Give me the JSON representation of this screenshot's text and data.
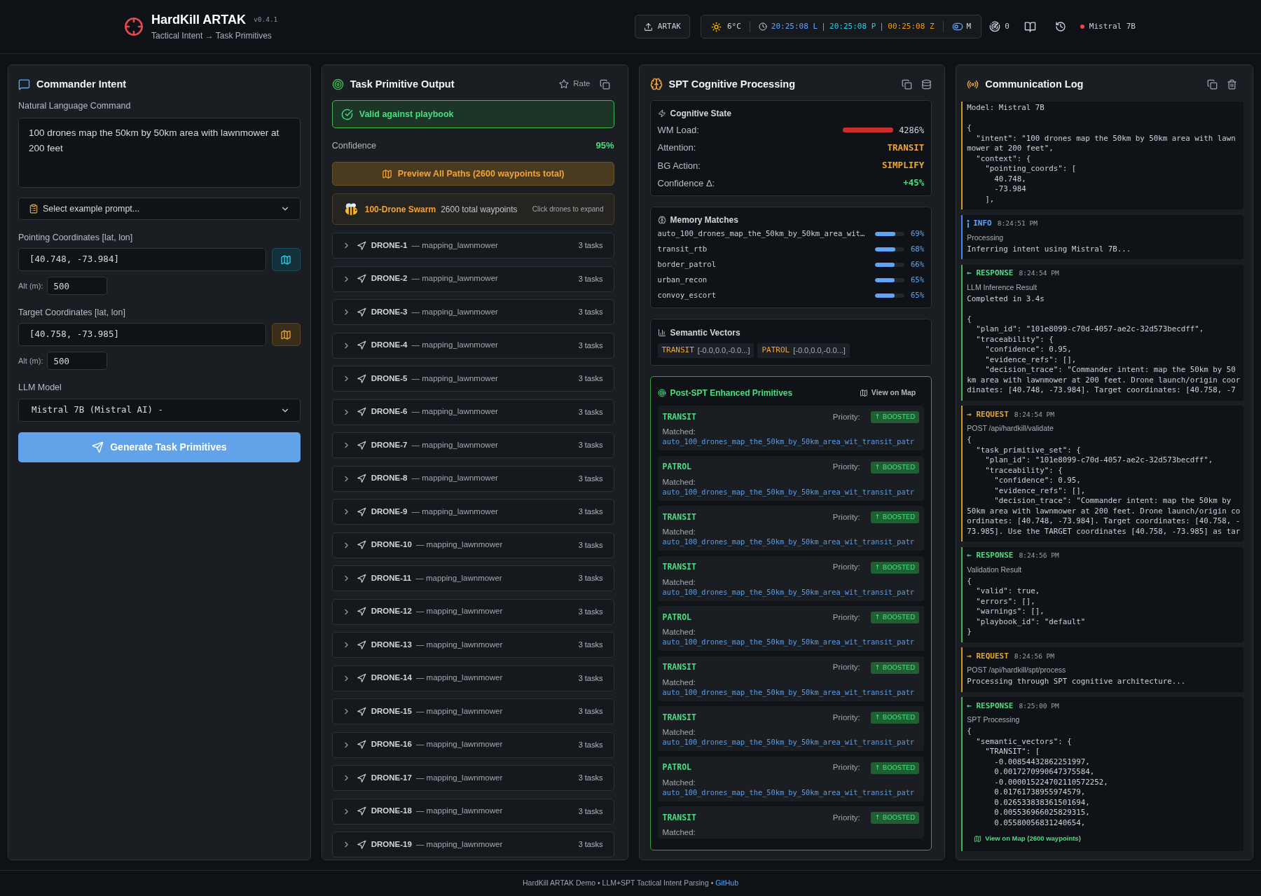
{
  "header": {
    "title": "HardKill ARTAK",
    "version": "v0.4.1",
    "subtitle": "Tactical Intent → Task Primitives",
    "export_button": "ARTAK",
    "temperature": "6°C",
    "clocks": [
      {
        "time": "20:25:08 L",
        "color": "#60a5fa"
      },
      {
        "time": "20:25:08 P",
        "color": "#22d3ee"
      },
      {
        "time": "00:25:08 Z",
        "color": "#f59e0b"
      }
    ],
    "mode": "M",
    "count": "0",
    "model_status": {
      "label": "Mistral 7B",
      "connected": false
    }
  },
  "commander_intent": {
    "title": "Commander Intent",
    "command": {
      "label": "Natural Language Command",
      "value": "100 drones map the 50km by 50km area with lawnmower at 200 feet"
    },
    "example_select": "Select example prompt...",
    "coordinates": [
      {
        "kind": "pointing",
        "label": "Pointing Coordinates [lat, lon]",
        "value": "[40.748, -73.984]",
        "alt_label": "Alt (m):",
        "alt_value": "500"
      },
      {
        "kind": "target",
        "label": "Target Coordinates [lat, lon]",
        "value": "[40.758, -73.985]",
        "alt_label": "Alt (m):",
        "alt_value": "500"
      }
    ],
    "model": {
      "label": "LLM Model",
      "value": "Mistral 7B (Mistral AI) -"
    },
    "generate_button": "Generate Task Primitives"
  },
  "task_output": {
    "title": "Task Primitive Output",
    "rate_button": "Rate",
    "validation": {
      "valid": true,
      "message": "Valid against playbook"
    },
    "confidence": {
      "label": "Confidence",
      "value": "95%"
    },
    "preview_button": "Preview All Paths (2600 waypoints total)",
    "swarm": {
      "name": "100-Drone Swarm",
      "waypoints": "2600 total waypoints",
      "hint": "Click drones to expand"
    },
    "drones": [
      {
        "name": "DRONE-1",
        "pattern": "— mapping_lawnmower",
        "tasks": "3 tasks",
        "expanded": false
      },
      {
        "name": "DRONE-2",
        "pattern": "— mapping_lawnmower",
        "tasks": "3 tasks",
        "expanded": false
      },
      {
        "name": "DRONE-3",
        "pattern": "— mapping_lawnmower",
        "tasks": "3 tasks",
        "expanded": false
      },
      {
        "name": "DRONE-4",
        "pattern": "— mapping_lawnmower",
        "tasks": "3 tasks",
        "expanded": false
      },
      {
        "name": "DRONE-5",
        "pattern": "— mapping_lawnmower",
        "tasks": "3 tasks",
        "expanded": false
      },
      {
        "name": "DRONE-6",
        "pattern": "— mapping_lawnmower",
        "tasks": "3 tasks",
        "expanded": false
      },
      {
        "name": "DRONE-7",
        "pattern": "— mapping_lawnmower",
        "tasks": "3 tasks",
        "expanded": false
      },
      {
        "name": "DRONE-8",
        "pattern": "— mapping_lawnmower",
        "tasks": "3 tasks",
        "expanded": false
      },
      {
        "name": "DRONE-9",
        "pattern": "— mapping_lawnmower",
        "tasks": "3 tasks",
        "expanded": false
      },
      {
        "name": "DRONE-10",
        "pattern": "— mapping_lawnmower",
        "tasks": "3 tasks",
        "expanded": false
      },
      {
        "name": "DRONE-11",
        "pattern": "— mapping_lawnmower",
        "tasks": "3 tasks",
        "expanded": false
      },
      {
        "name": "DRONE-12",
        "pattern": "— mapping_lawnmower",
        "tasks": "3 tasks",
        "expanded": false
      },
      {
        "name": "DRONE-13",
        "pattern": "— mapping_lawnmower",
        "tasks": "3 tasks",
        "expanded": false
      },
      {
        "name": "DRONE-14",
        "pattern": "— mapping_lawnmower",
        "tasks": "3 tasks",
        "expanded": false
      },
      {
        "name": "DRONE-15",
        "pattern": "— mapping_lawnmower",
        "tasks": "3 tasks",
        "expanded": false
      },
      {
        "name": "DRONE-16",
        "pattern": "— mapping_lawnmower",
        "tasks": "3 tasks",
        "expanded": false
      },
      {
        "name": "DRONE-17",
        "pattern": "— mapping_lawnmower",
        "tasks": "3 tasks",
        "expanded": false
      },
      {
        "name": "DRONE-18",
        "pattern": "— mapping_lawnmower",
        "tasks": "3 tasks",
        "expanded": false
      },
      {
        "name": "DRONE-19",
        "pattern": "— mapping_lawnmower",
        "tasks": "3 tasks",
        "expanded": false
      }
    ]
  },
  "spt": {
    "title": "SPT Cognitive Processing",
    "cognitive_state": {
      "title": "Cognitive State",
      "rows": [
        {
          "kind": "meter",
          "label": "WM Load:",
          "level": 1,
          "reading": "4286%"
        },
        {
          "kind": "value",
          "label": "Attention:",
          "value": "TRANSIT",
          "color": "#f0a43a"
        },
        {
          "kind": "value",
          "label": "BG Action:",
          "value": "SIMPLIFY",
          "color": "#f0a43a"
        },
        {
          "kind": "value",
          "label": "Confidence Δ:",
          "value": "+45%",
          "color": "#4ade80"
        }
      ]
    },
    "memory_matches": {
      "title": "Memory Matches",
      "items": [
        {
          "name": "auto_100_drones_map_the_50km_by_50km_area_wit…",
          "level": 0.69,
          "reading": "69%"
        },
        {
          "name": "transit_rtb",
          "level": 0.68,
          "reading": "68%"
        },
        {
          "name": "border_patrol",
          "level": 0.66,
          "reading": "66%"
        },
        {
          "name": "urban_recon",
          "level": 0.65,
          "reading": "65%"
        },
        {
          "name": "convoy_escort",
          "level": 0.65,
          "reading": "65%"
        }
      ]
    },
    "semantic_vectors": {
      "title": "Semantic Vectors",
      "items": [
        {
          "name": "TRANSIT",
          "values": "[-0.0,0.0,-0.0...]"
        },
        {
          "name": "PATROL",
          "values": "[-0.0,0.0,-0.0...]"
        }
      ]
    },
    "enhanced_primitives": {
      "title": "Post-SPT Enhanced Primitives",
      "map_link": "View on Map",
      "items": [
        {
          "type": "TRANSIT",
          "priority_label": "Priority:",
          "priority": "↑ BOOSTED",
          "matched_label": "Matched:",
          "matched": "auto_100_drones_map_the_50km_by_50km_area_wit_transit_patr"
        },
        {
          "type": "PATROL",
          "priority_label": "Priority:",
          "priority": "↑ BOOSTED",
          "matched_label": "Matched:",
          "matched": "auto_100_drones_map_the_50km_by_50km_area_wit_transit_patr"
        },
        {
          "type": "TRANSIT",
          "priority_label": "Priority:",
          "priority": "↑ BOOSTED",
          "matched_label": "Matched:",
          "matched": "auto_100_drones_map_the_50km_by_50km_area_wit_transit_patr"
        },
        {
          "type": "TRANSIT",
          "priority_label": "Priority:",
          "priority": "↑ BOOSTED",
          "matched_label": "Matched:",
          "matched": "auto_100_drones_map_the_50km_by_50km_area_wit_transit_patr"
        },
        {
          "type": "PATROL",
          "priority_label": "Priority:",
          "priority": "↑ BOOSTED",
          "matched_label": "Matched:",
          "matched": "auto_100_drones_map_the_50km_by_50km_area_wit_transit_patr"
        },
        {
          "type": "TRANSIT",
          "priority_label": "Priority:",
          "priority": "↑ BOOSTED",
          "matched_label": "Matched:",
          "matched": "auto_100_drones_map_the_50km_by_50km_area_wit_transit_patr"
        },
        {
          "type": "TRANSIT",
          "priority_label": "Priority:",
          "priority": "↑ BOOSTED",
          "matched_label": "Matched:",
          "matched": "auto_100_drones_map_the_50km_by_50km_area_wit_transit_patr"
        },
        {
          "type": "PATROL",
          "priority_label": "Priority:",
          "priority": "↑ BOOSTED",
          "matched_label": "Matched:",
          "matched": "auto_100_drones_map_the_50km_by_50km_area_wit_transit_patr"
        },
        {
          "type": "TRANSIT",
          "priority_label": "Priority:",
          "priority": "↑ BOOSTED",
          "matched_label": "Matched:"
        }
      ]
    }
  },
  "communication_log": {
    "title": "Communication Log",
    "entries": [
      {
        "kind": "request",
        "body": "Model: Mistral 7B\n\n{\n  \"intent\": \"100 drones map the 50km by 50km area with lawn\nmower at 200 feet\",\n  \"context\": {\n    \"pointing_coords\": [\n      40.748,\n      -73.984\n    ],"
      },
      {
        "kind": "info",
        "label": "INFO",
        "time": "8:24:51 PM",
        "subtitle": "Processing",
        "body": "Inferring intent using Mistral 7B..."
      },
      {
        "kind": "response",
        "label": "← RESPONSE",
        "time": "8:24:54 PM",
        "subtitle": "LLM Inference Result",
        "body": "Completed in 3.4s\n\n{\n  \"plan_id\": \"101e8099-c70d-4057-ae2c-32d573becdff\",\n  \"traceability\": {\n    \"confidence\": 0.95,\n    \"evidence_refs\": [],\n    \"decision_trace\": \"Commander intent: map the 50km by 50\nkm area with lawnmower at 200 feet. Drone launch/origin coor\ndinates: [40.748, -73.984]. Target coordinates: [40.758, -7"
      },
      {
        "kind": "request",
        "label": "→ REQUEST",
        "time": "8:24:54 PM",
        "subtitle": "POST /api/hardkill/validate",
        "body": "{\n  \"task_primitive_set\": {\n    \"plan_id\": \"101e8099-c70d-4057-ae2c-32d573becdff\",\n    \"traceability\": {\n      \"confidence\": 0.95,\n      \"evidence_refs\": [],\n      \"decision_trace\": \"Commander intent: map the 50km by\n50km area with lawnmower at 200 feet. Drone launch/origin co\nordinates: [40.748, -73.984]. Target coordinates: [40.758, -\n73.985]. Use the TARGET coordinates [40.758, -73.985] as tar"
      },
      {
        "kind": "response",
        "label": "← RESPONSE",
        "time": "8:24:56 PM",
        "subtitle": "Validation Result",
        "body": "{\n  \"valid\": true,\n  \"errors\": [],\n  \"warnings\": [],\n  \"playbook_id\": \"default\"\n}"
      },
      {
        "kind": "request",
        "label": "→ REQUEST",
        "time": "8:24:56 PM",
        "subtitle": "POST /api/hardkill/spt/process",
        "body": "Processing through SPT cognitive architecture..."
      },
      {
        "kind": "response",
        "label": "← RESPONSE",
        "time": "8:25:00 PM",
        "subtitle": "SPT Processing",
        "body": "{\n  \"semantic_vectors\": {\n    \"TRANSIT\": [\n      -0.00854432862251997,\n      0.0017270990647375584,\n      -0.000015224702110572252,\n      0.01761738955974579,\n      0.026533838361501694,\n      0.005536966025829315,\n      0.05580056831240654,",
        "link": "View on Map (2600 waypoints)"
      }
    ]
  },
  "footer": {
    "text": "HardKill ARTAK Demo • LLM+SPT Tactical Intent Parsing •",
    "link": "GitHub"
  }
}
